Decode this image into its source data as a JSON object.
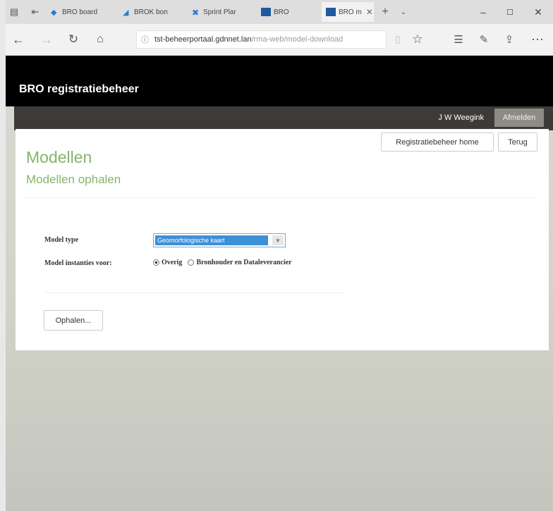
{
  "browser": {
    "tabs": [
      {
        "label": "BRO board"
      },
      {
        "label": "BROK bon"
      },
      {
        "label": "Sprint Plar"
      },
      {
        "label": "BRO"
      },
      {
        "label": "BRO m"
      }
    ],
    "url_host": "tst-beheerportaal.gdnnet.lan",
    "url_path": "/rma-web/model-download"
  },
  "header": {
    "brand": "BRO registratiebeheer",
    "username": "J W Weegink",
    "logout_label": "Afmelden"
  },
  "toolbar": {
    "home_label": "Registratiebeheer home",
    "back_label": "Terug"
  },
  "main": {
    "title": "Modellen",
    "subtitle": "Modellen ophalen",
    "model_type_label": "Model type",
    "model_type_value": "Geomorfologische kaart",
    "instances_label": "Model instanties voor:",
    "radio_options": [
      {
        "label": "Overig",
        "selected": true
      },
      {
        "label": "Bronhouder en Dataleverancier",
        "selected": false
      }
    ],
    "submit_label": "Ophalen..."
  }
}
